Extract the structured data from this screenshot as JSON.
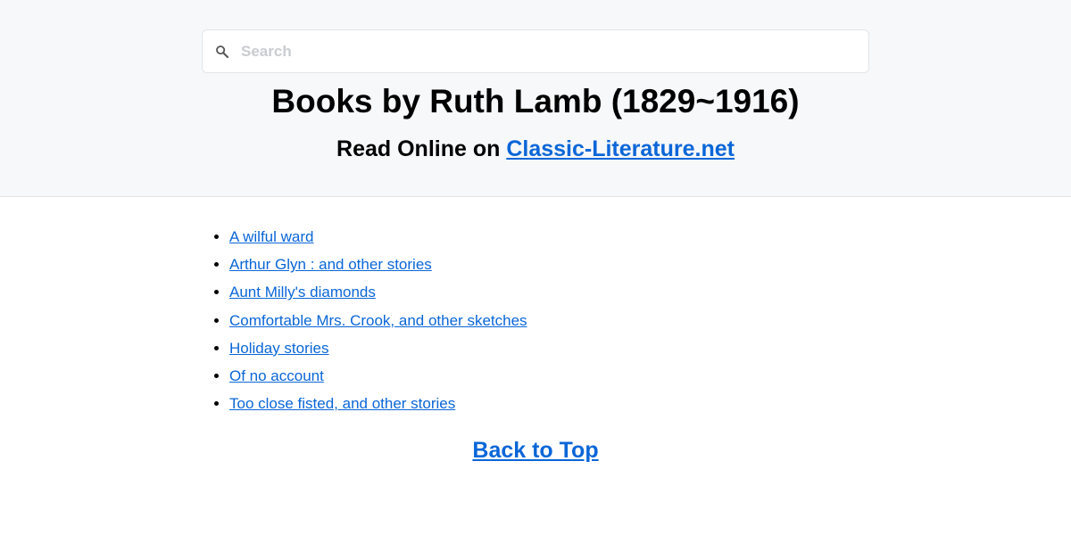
{
  "search": {
    "placeholder": "Search"
  },
  "header": {
    "title": "Books by Ruth Lamb (1829~1916)",
    "subtitle_prefix": "Read Online on ",
    "site_link": "Classic-Literature.net"
  },
  "books": [
    "A wilful ward",
    "Arthur Glyn : and other stories",
    "Aunt Milly's diamonds",
    "Comfortable Mrs. Crook, and other sketches",
    "Holiday stories",
    "Of no account",
    "Too close fisted, and other stories"
  ],
  "footer": {
    "back_to_top": "Back to Top"
  },
  "colors": {
    "link": "#0a66d8",
    "header_bg": "#f7f8fa",
    "icon": "#555555"
  }
}
